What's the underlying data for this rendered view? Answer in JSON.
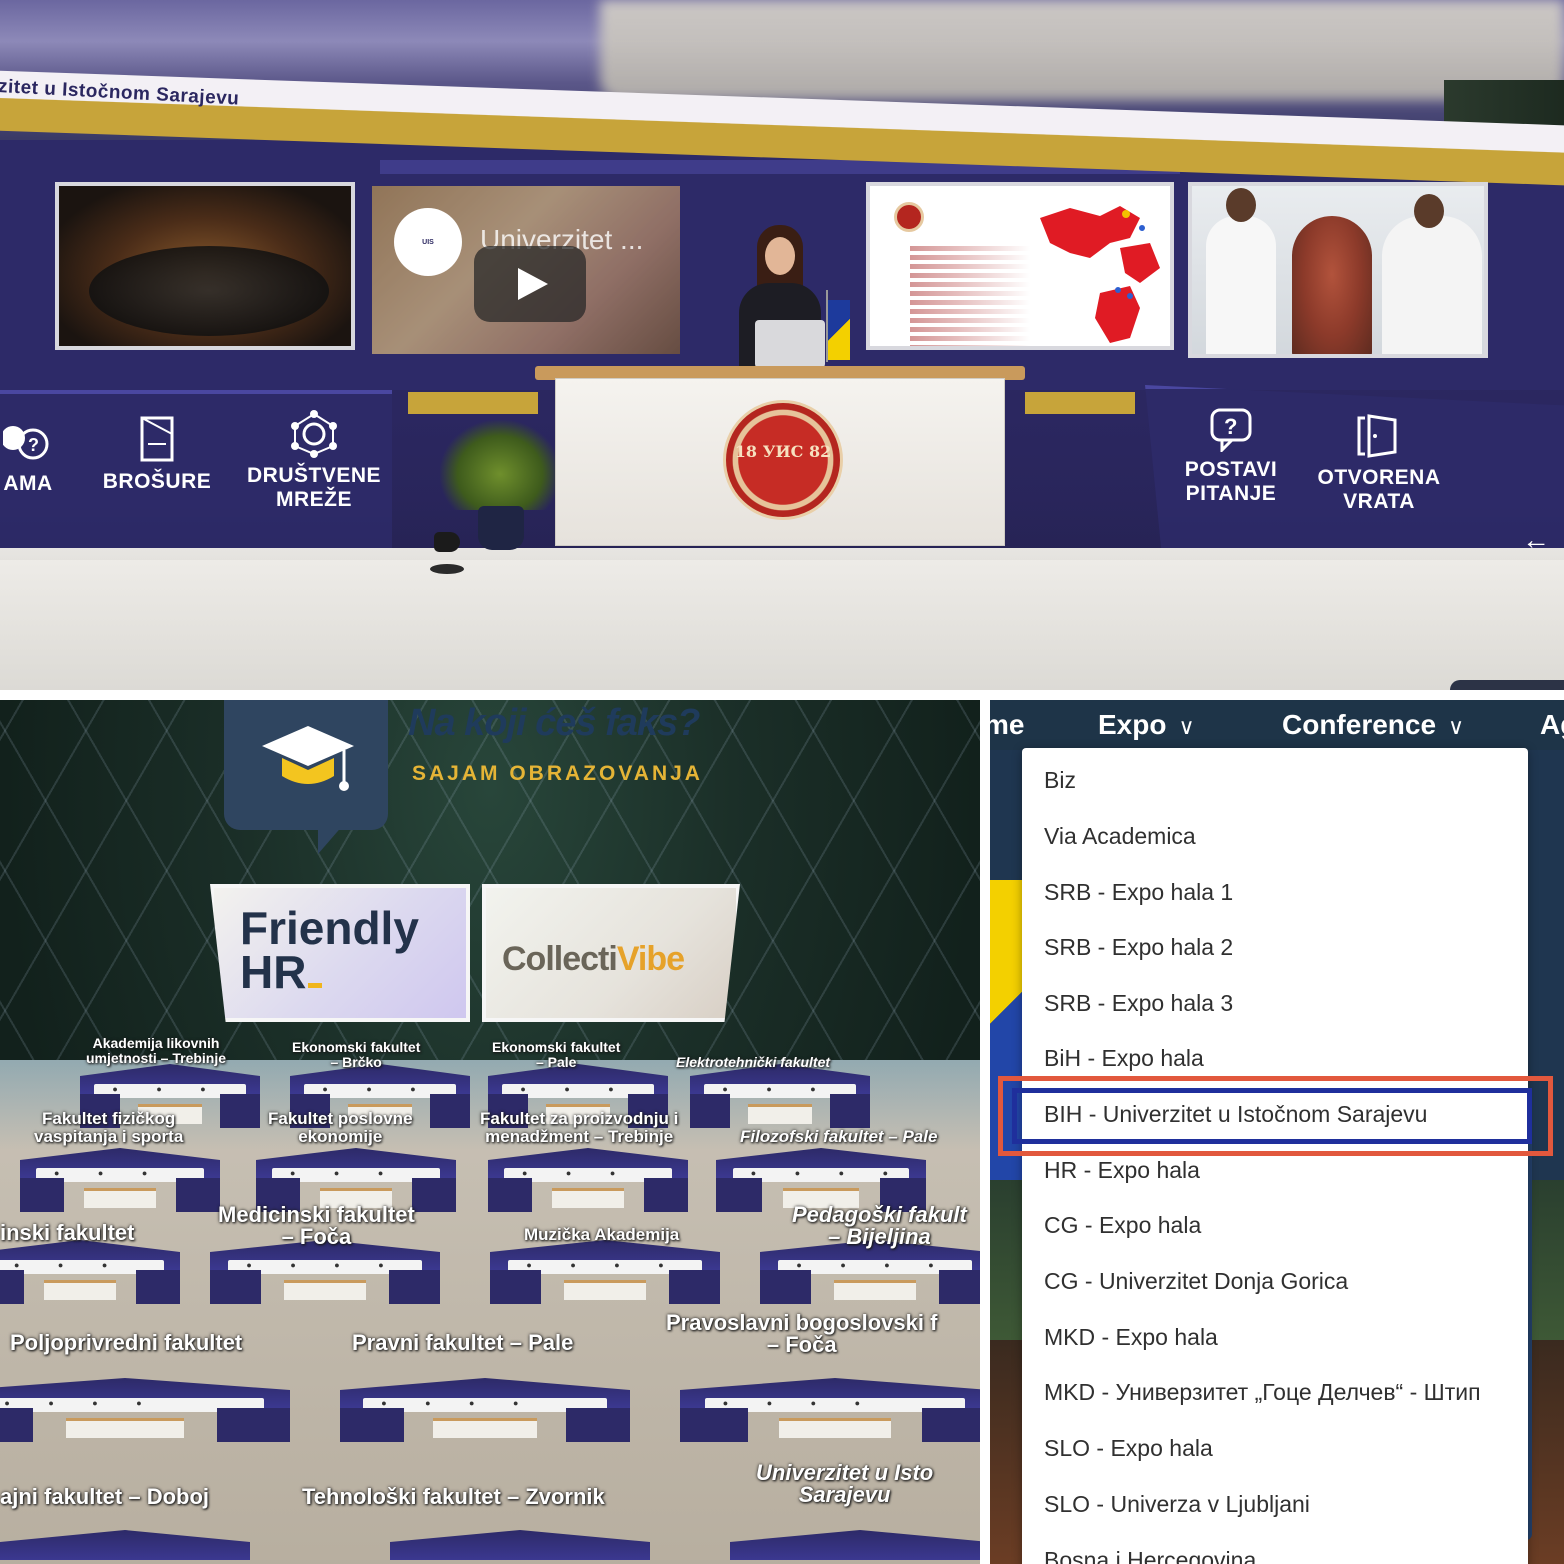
{
  "booth": {
    "header_text": "zitet u Istočnom Sarajevu",
    "video_title": "Univerzitet ...",
    "counter_seal_text": "18 УИС 82",
    "menu": [
      {
        "label": "AMA",
        "icon": "question-bubbles-icon"
      },
      {
        "label": "BROŠURE",
        "icon": "brochure-icon"
      },
      {
        "label": "DRUŠTVENE MREŽE",
        "icon": "network-icon"
      },
      {
        "label": "POSTAVI PITANJE",
        "icon": "question-icon"
      },
      {
        "label": "OTVORENA VRATA",
        "icon": "door-icon"
      }
    ],
    "arrow": "←"
  },
  "hall": {
    "title": "Na koji ćeš faks?",
    "subtitle": "SAJAM OBRAZOVANJA",
    "sponsors": {
      "friendly_line1": "Friendly",
      "friendly_line2": "HR",
      "collecti_a": "Collecti",
      "collecti_b": "Vibe"
    },
    "labels": {
      "l1": "Akademija likovnih\numjetnosti – Trebinje",
      "l2": "Ekonomski fakultet\n– Brčko",
      "l3": "Ekonomski fakultet\n– Pale",
      "l4": "Elektrotehnički fakultet",
      "l5": "Fakultet fizičkog\nvaspitanja i sporta",
      "l6": "Fakultet poslovne\nekonomije",
      "l7": "Fakultet za proizvodnju i\nmenadžment – Trebinje",
      "l8": "Filozofski fakultet – Pale",
      "l9": "inski fakultet",
      "l10": "Medicinski fakultet\n– Foča",
      "l11": "Muzička Akademija",
      "l12": "Pedagoški fakult\n– Bijeljina",
      "l13": "Poljoprivredni fakultet",
      "l14": "Pravni fakultet – Pale",
      "l15": "Pravoslavni bogoslovski f\n– Foča",
      "l16": "ajni fakultet – Doboj",
      "l17": "Tehnološki fakultet – Zvornik",
      "l18": "Univerzitet u Isto\nSarajevu"
    }
  },
  "nav": {
    "items": [
      "me",
      "Expo",
      "Conference",
      "Ag"
    ],
    "dropdown": [
      "Biz",
      "Via Academica",
      "SRB - Expo hala 1",
      "SRB - Expo hala 2",
      "SRB - Expo hala 3",
      "BiH - Expo hala",
      "BIH - Univerzitet u Istočnom Sarajevu",
      "HR - Expo hala",
      "CG - Expo hala",
      "CG - Univerzitet Donja Gorica",
      "MKD - Expo hala",
      "MKD - Универзитет „Гоце Делчев“ - Штип",
      "SLO - Expo hala",
      "SLO - Univerza v Ljubljani",
      "Bosna i Hercegovina"
    ],
    "selected": "BIH - Univerzitet u Istočnom Sarajevu",
    "highlight_colors": {
      "outer": "#e2583d",
      "inner": "#1f2f9c"
    }
  }
}
